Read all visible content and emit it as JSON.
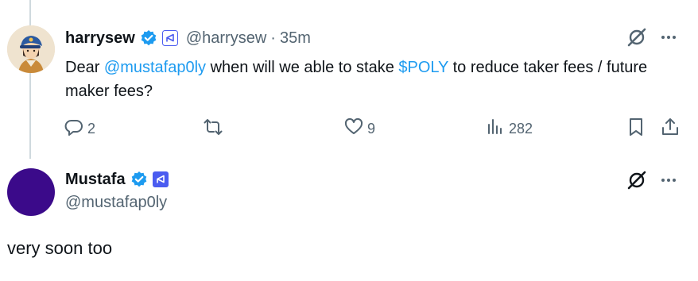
{
  "tweet": {
    "author_name": "harrysew",
    "author_handle": "@harrysew",
    "separator": "·",
    "time": "35m",
    "text_parts": {
      "p1": "Dear ",
      "mention": "@mustafap0ly",
      "p2": " when will we able to stake ",
      "cashtag": "$POLY",
      "p3": " to reduce taker fees / future maker fees?"
    },
    "replies": "2",
    "likes": "9",
    "views": "282"
  },
  "reply": {
    "author_name": "Mustafa",
    "author_handle": "@mustafap0ly",
    "text": "very soon too"
  },
  "colors": {
    "accent": "#1d9bf0",
    "secondary_text": "#536471",
    "verified_badge": "#1d9bf0",
    "org_badge": "#4b5cf0"
  },
  "icons": [
    "verified-badge-icon",
    "org-badge-icon",
    "grok-icon",
    "more-icon",
    "reply-icon",
    "retweet-icon",
    "like-icon",
    "views-icon",
    "bookmark-icon",
    "share-icon"
  ]
}
